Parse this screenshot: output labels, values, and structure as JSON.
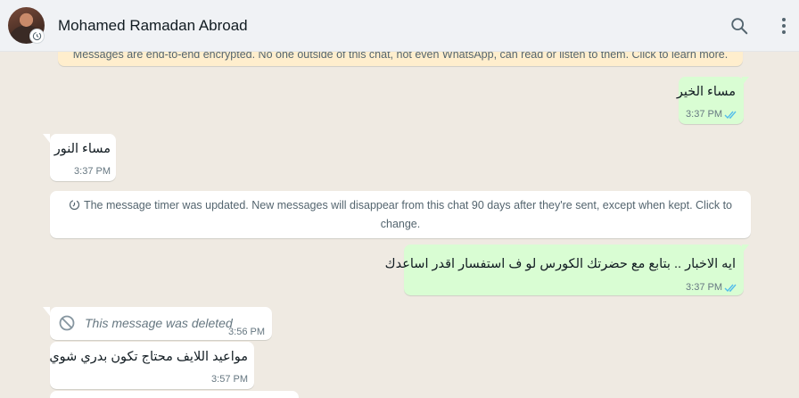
{
  "header": {
    "contact_name": "Mohamed Ramadan Abroad",
    "icons": [
      "search-icon",
      "menu-icon",
      "timer-badge-icon"
    ]
  },
  "chat": {
    "encryption_banner": "Messages are end-to-end encrypted. No one outside of this chat, not even WhatsApp, can read or listen to them. Click to learn more.",
    "messages": [
      {
        "direction": "out",
        "text": "مساء الخير",
        "time": "3:37 PM",
        "status": "read"
      },
      {
        "direction": "in",
        "text": "مساء النور",
        "time": "3:37 PM"
      },
      {
        "direction": "out",
        "text": "ايه الاخبار .. بتابع مع حضرتك الكورس لو ف استفسار اقدر اساعدك",
        "time": "3:37 PM",
        "status": "read"
      },
      {
        "direction": "in",
        "text": "This message was deleted",
        "time": "3:56 PM",
        "deleted": true
      },
      {
        "direction": "in",
        "text": "مواعيد اللايف محتاج تكون بدري شوي",
        "time": "3:57 PM"
      }
    ],
    "system_message": "The message timer was updated. New messages will disappear from this chat 90 days after they're sent, except when kept. Click to change."
  },
  "colors": {
    "chat_bg": "#efeae2",
    "outgoing_bubble": "#d9fdd3",
    "incoming_bubble": "#ffffff",
    "read_ticks": "#53bdeb",
    "banner_bg": "#ffeecd"
  }
}
